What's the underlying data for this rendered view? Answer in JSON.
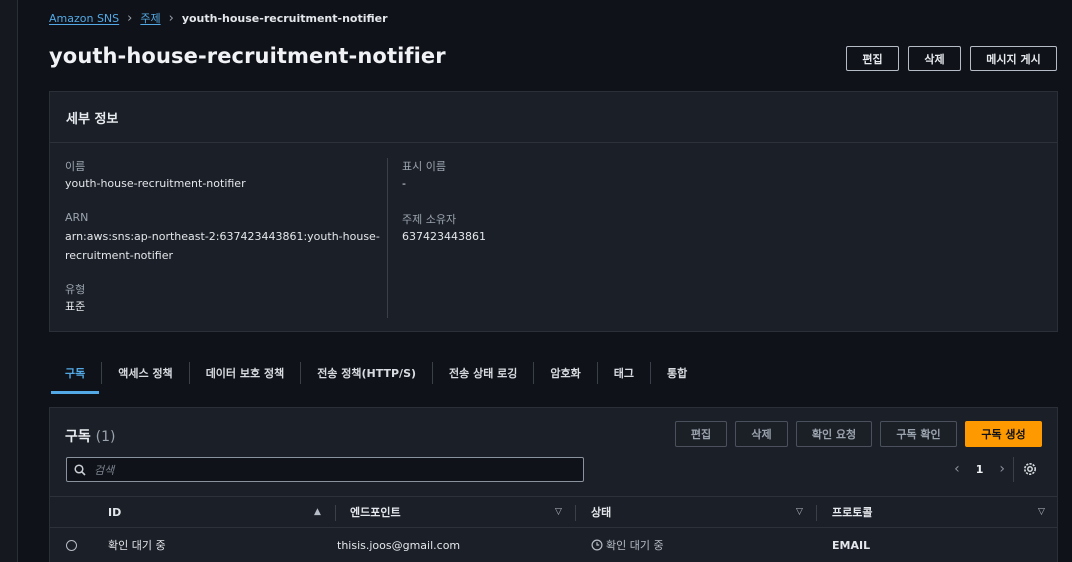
{
  "breadcrumb": {
    "root": "Amazon SNS",
    "section": "주제",
    "current": "youth-house-recruitment-notifier"
  },
  "page": {
    "title": "youth-house-recruitment-notifier",
    "actions": {
      "edit": "편집",
      "delete": "삭제",
      "publish": "메시지 게시"
    }
  },
  "details": {
    "heading": "세부 정보",
    "name_label": "이름",
    "name_value": "youth-house-recruitment-notifier",
    "arn_label": "ARN",
    "arn_line1": "arn:aws:sns:ap-northeast-2:637423443861:youth-house-",
    "arn_line2": "recruitment-notifier",
    "type_label": "유형",
    "type_value": "표준",
    "display_name_label": "표시 이름",
    "display_name_value": "-",
    "owner_label": "주제 소유자",
    "owner_value": "637423443861"
  },
  "tabs": [
    {
      "label": "구독"
    },
    {
      "label": "액세스 정책"
    },
    {
      "label": "데이터 보호 정책"
    },
    {
      "label": "전송 정책(HTTP/S)"
    },
    {
      "label": "전송 상태 로깅"
    },
    {
      "label": "암호화"
    },
    {
      "label": "태그"
    },
    {
      "label": "통합"
    }
  ],
  "subscriptions": {
    "title": "구독",
    "count": "(1)",
    "actions": {
      "edit": "편집",
      "delete": "삭제",
      "request_confirm": "확인 요청",
      "confirm": "구독 확인",
      "create": "구독 생성"
    },
    "search_placeholder": "검색",
    "page_number": "1",
    "columns": {
      "id": "ID",
      "endpoint": "엔드포인트",
      "status": "상태",
      "protocol": "프로토콜"
    },
    "rows": [
      {
        "id": "확인 대기 중",
        "endpoint": "thisis.joos@gmail.com",
        "status": "확인 대기 중",
        "protocol": "EMAIL"
      }
    ]
  },
  "colors": {
    "accent": "#53a9e5",
    "primary_button": "#ff9900",
    "panel": "#1b1f27",
    "background": "#0f1218"
  }
}
